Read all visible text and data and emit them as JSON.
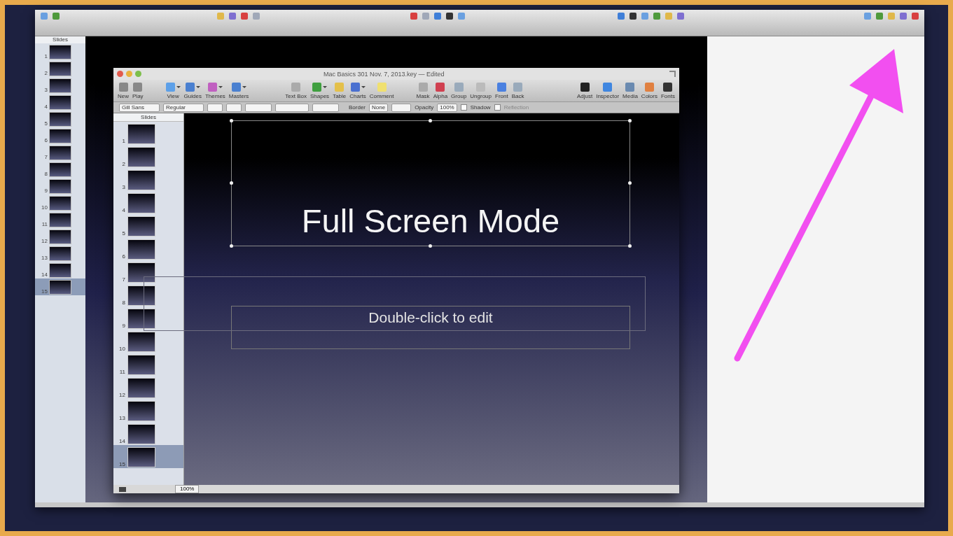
{
  "outer_window": {
    "sidebar": {
      "header": "Slides",
      "slides": [
        {
          "number": "1",
          "selected": false
        },
        {
          "number": "2",
          "selected": false
        },
        {
          "number": "3",
          "selected": false
        },
        {
          "number": "4",
          "selected": false
        },
        {
          "number": "5",
          "selected": false
        },
        {
          "number": "6",
          "selected": false
        },
        {
          "number": "7",
          "selected": false
        },
        {
          "number": "8",
          "selected": false
        },
        {
          "number": "9",
          "selected": false
        },
        {
          "number": "10",
          "selected": false
        },
        {
          "number": "11",
          "selected": false
        },
        {
          "number": "12",
          "selected": false
        },
        {
          "number": "13",
          "selected": false
        },
        {
          "number": "14",
          "selected": false
        },
        {
          "number": "15",
          "selected": true
        }
      ]
    }
  },
  "inner_window": {
    "title": "Mac Basics 301 Nov. 7, 2013.key — Edited",
    "toolbar": [
      [
        {
          "label": "New",
          "has_menu": false
        },
        {
          "label": "Play",
          "has_menu": false
        }
      ],
      [
        {
          "label": "View",
          "has_menu": true
        },
        {
          "label": "Guides",
          "has_menu": true
        },
        {
          "label": "Themes",
          "has_menu": true
        },
        {
          "label": "Masters",
          "has_menu": true
        }
      ],
      [
        {
          "label": "Text Box",
          "has_menu": false
        },
        {
          "label": "Shapes",
          "has_menu": true
        },
        {
          "label": "Table",
          "has_menu": false
        },
        {
          "label": "Charts",
          "has_menu": true
        },
        {
          "label": "Comment",
          "has_menu": false
        }
      ],
      [
        {
          "label": "Mask",
          "has_menu": false
        },
        {
          "label": "Alpha",
          "has_menu": false
        },
        {
          "label": "Group",
          "has_menu": false
        },
        {
          "label": "Ungroup",
          "has_menu": false
        },
        {
          "label": "Front",
          "has_menu": false
        },
        {
          "label": "Back",
          "has_menu": false
        }
      ],
      [
        {
          "label": "Adjust",
          "has_menu": false
        },
        {
          "label": "Inspector",
          "has_menu": false
        },
        {
          "label": "Media",
          "has_menu": false
        },
        {
          "label": "Colors",
          "has_menu": false
        },
        {
          "label": "Fonts",
          "has_menu": false
        }
      ]
    ],
    "format_bar": {
      "font": "Gill Sans",
      "style": "Regular",
      "border_label": "Border",
      "border_value": "None",
      "opacity_label": "Opacity",
      "opacity_value": "100%",
      "shadow": {
        "label": "Shadow",
        "checked": false
      },
      "reflection": {
        "label": "Reflection",
        "checked": false
      }
    },
    "sidebar": {
      "header": "Slides",
      "slides": [
        {
          "number": "1",
          "selected": false
        },
        {
          "number": "2",
          "selected": false
        },
        {
          "number": "3",
          "selected": false
        },
        {
          "number": "4",
          "selected": false
        },
        {
          "number": "5",
          "selected": false
        },
        {
          "number": "6",
          "selected": false
        },
        {
          "number": "7",
          "selected": false
        },
        {
          "number": "8",
          "selected": false
        },
        {
          "number": "9",
          "selected": false
        },
        {
          "number": "10",
          "selected": false
        },
        {
          "number": "11",
          "selected": false
        },
        {
          "number": "12",
          "selected": false
        },
        {
          "number": "13",
          "selected": false
        },
        {
          "number": "14",
          "selected": false
        },
        {
          "number": "15",
          "selected": true
        }
      ]
    },
    "slide": {
      "title": "Full Screen Mode",
      "placeholder": "Double-click to edit"
    },
    "zoom": "100%"
  }
}
